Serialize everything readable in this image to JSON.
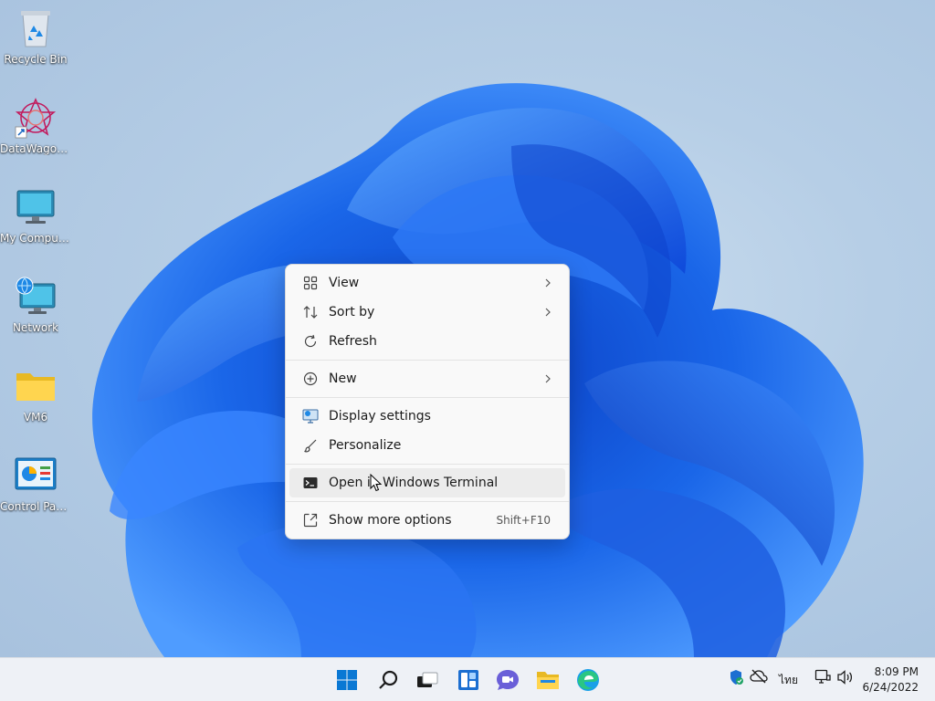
{
  "desktop": {
    "icons": [
      {
        "label": "Recycle Bin",
        "icon": "recycle-bin-icon"
      },
      {
        "label": "DataWagon...",
        "icon": "datawagon-icon"
      },
      {
        "label": "My Computer",
        "icon": "my-computer-icon"
      },
      {
        "label": "Network",
        "icon": "network-icon"
      },
      {
        "label": "VM6",
        "icon": "folder-icon"
      },
      {
        "label": "Control Panel",
        "icon": "control-panel-icon"
      }
    ]
  },
  "context_menu": {
    "items": [
      {
        "label": "View",
        "icon": "grid-view-icon",
        "submenu": true
      },
      {
        "label": "Sort by",
        "icon": "sort-icon",
        "submenu": true
      },
      {
        "label": "Refresh",
        "icon": "refresh-icon"
      },
      {
        "label": "New",
        "icon": "plus-circle-icon",
        "submenu": true
      },
      {
        "label": "Display settings",
        "icon": "display-settings-icon"
      },
      {
        "label": "Personalize",
        "icon": "brush-icon"
      },
      {
        "label": "Open in Windows Terminal",
        "icon": "terminal-icon"
      },
      {
        "label": "Show more options",
        "icon": "show-more-icon",
        "shortcut": "Shift+F10"
      }
    ]
  },
  "taskbar": {
    "apps": [
      "start-icon",
      "search-icon",
      "task-view-icon",
      "widgets-icon",
      "chat-icon",
      "file-explorer-icon",
      "edge-icon"
    ],
    "language": "ไทย",
    "time": "8:09 PM",
    "date": "6/24/2022"
  },
  "colors": {
    "accent": "#0067c0",
    "wallpaper_bloom": "#1a66e8",
    "menu_bg": "#f9f9f9",
    "taskbar_bg": "#eef1f6"
  }
}
